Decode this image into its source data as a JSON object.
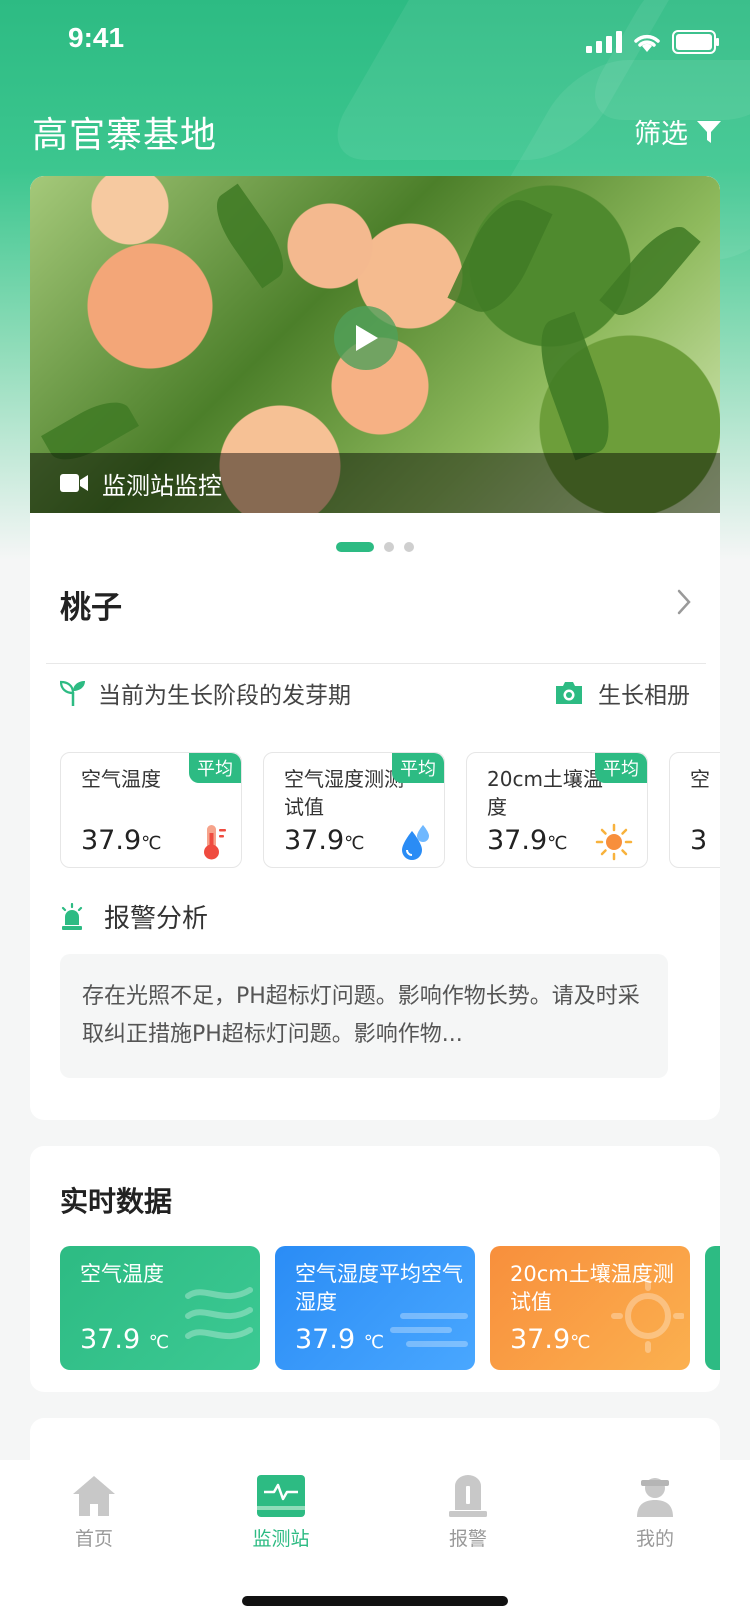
{
  "status_bar": {
    "time": "9:41"
  },
  "header": {
    "title": "高官寨基地",
    "filter_label": "筛选"
  },
  "video": {
    "caption": "监测站监控",
    "carousel_pages": 3,
    "carousel_active": 1
  },
  "crop": {
    "name": "桃子",
    "stage_text": "当前为生长阶段的发芽期",
    "album_label": "生长相册"
  },
  "metrics": [
    {
      "label": "空气温度",
      "badge": "平均",
      "value": "37.9",
      "unit": "℃",
      "icon": "thermometer-icon"
    },
    {
      "label": "空气湿度测测试值",
      "badge": "平均",
      "value": "37.9",
      "unit": "℃",
      "icon": "water-drop-icon"
    },
    {
      "label": "20cm土壤温度",
      "badge": "平均",
      "value": "37.9",
      "unit": "℃",
      "icon": "sun-icon"
    },
    {
      "label": "空",
      "badge": "",
      "value": "3",
      "unit": "",
      "icon": ""
    }
  ],
  "alert": {
    "title": "报警分析",
    "text": "存在光照不足，PH超标灯问题。影响作物长势。请及时采取纠正措施PH超标灯问题。影响作物..."
  },
  "realtime": {
    "title": "实时数据",
    "tiles": [
      {
        "label": "空气温度",
        "value": "37.9",
        "unit": "℃",
        "color": "#2dbb83"
      },
      {
        "label": "空气湿度平均空气湿度",
        "value": "37.9",
        "unit": "℃",
        "color": "#2a8cf5"
      },
      {
        "label": "20cm土壤温度测试值",
        "value": "37.9",
        "unit": "℃",
        "color": "#f88f3c"
      }
    ]
  },
  "tabbar": {
    "items": [
      {
        "label": "首页",
        "icon": "home-icon",
        "active": false
      },
      {
        "label": "监测站",
        "icon": "monitor-icon",
        "active": true
      },
      {
        "label": "报警",
        "icon": "alarm-icon",
        "active": false
      },
      {
        "label": "我的",
        "icon": "user-icon",
        "active": false
      }
    ]
  },
  "colors": {
    "accent": "#2dbb83",
    "blue": "#2a8cf5",
    "orange": "#f88f3c"
  }
}
